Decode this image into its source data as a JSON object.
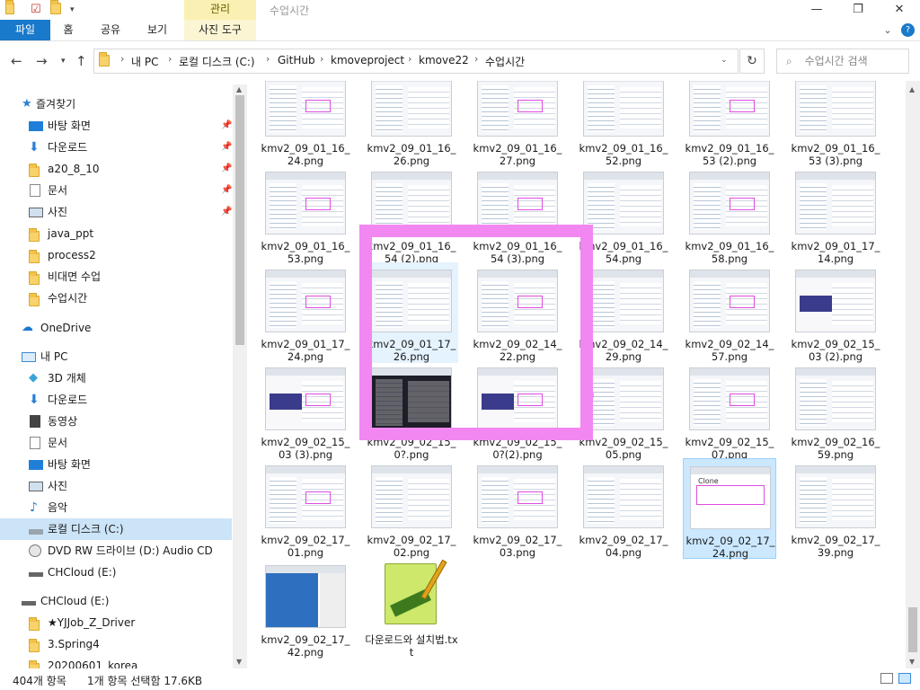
{
  "window": {
    "title": "수업시간",
    "context_tab": "관리",
    "minimize": "—",
    "maximize": "❐",
    "close": "✕"
  },
  "ribbon": {
    "tabs": [
      "파일",
      "홈",
      "공유",
      "보기",
      "사진 도구"
    ],
    "help": "?",
    "expand": "⌄"
  },
  "address": {
    "segments": [
      "내 PC",
      "로컬 디스크 (C:)",
      "GitHub",
      "kmoveproject",
      "kmove22",
      "수업시간"
    ],
    "search_placeholder": "수업시간 검색"
  },
  "sidebar": {
    "items": [
      {
        "label": "즐겨찾기",
        "icon": "star-icon",
        "pinned": false
      },
      {
        "label": "바탕 화면",
        "icon": "desktop-icon",
        "pinned": true
      },
      {
        "label": "다운로드",
        "icon": "download-icon",
        "pinned": true
      },
      {
        "label": "a20_8_10",
        "icon": "folder-icon",
        "pinned": true
      },
      {
        "label": "문서",
        "icon": "document-icon",
        "pinned": true
      },
      {
        "label": "사진",
        "icon": "pictures-icon",
        "pinned": true
      },
      {
        "label": "java_ppt",
        "icon": "folder-icon",
        "pinned": false
      },
      {
        "label": "process2",
        "icon": "folder-icon",
        "pinned": false
      },
      {
        "label": "비대면 수업",
        "icon": "folder-icon",
        "pinned": false
      },
      {
        "label": "수업시간",
        "icon": "folder-icon",
        "pinned": false
      },
      {
        "label": "OneDrive",
        "icon": "cloud-icon",
        "pinned": false
      },
      {
        "label": "내 PC",
        "icon": "pc-icon",
        "pinned": false
      },
      {
        "label": "3D 개체",
        "icon": "cube-icon",
        "pinned": false
      },
      {
        "label": "다운로드",
        "icon": "download-icon",
        "pinned": false
      },
      {
        "label": "동영상",
        "icon": "video-icon",
        "pinned": false
      },
      {
        "label": "문서",
        "icon": "document-icon",
        "pinned": false
      },
      {
        "label": "바탕 화면",
        "icon": "desktop-icon",
        "pinned": false
      },
      {
        "label": "사진",
        "icon": "pictures-icon",
        "pinned": false
      },
      {
        "label": "음악",
        "icon": "music-icon",
        "pinned": false
      },
      {
        "label": "로컬 디스크 (C:)",
        "icon": "drive-icon",
        "pinned": false
      },
      {
        "label": "DVD RW 드라이브 (D:) Audio CD",
        "icon": "dvd-icon",
        "pinned": false
      },
      {
        "label": "CHCloud (E:)",
        "icon": "drive-icon",
        "pinned": false
      },
      {
        "label": "CHCloud (E:)",
        "icon": "drive-icon",
        "pinned": false
      },
      {
        "label": "★YJJob_Z_Driver",
        "icon": "folder-icon",
        "pinned": false
      },
      {
        "label": "3.Spring4",
        "icon": "folder-icon",
        "pinned": false
      },
      {
        "label": "20200601_korea",
        "icon": "folder-icon",
        "pinned": false
      }
    ]
  },
  "files": [
    "kmv2_09_01_16_24.png",
    "kmv2_09_01_16_26.png",
    "kmv2_09_01_16_27.png",
    "kmv2_09_01_16_52.png",
    "kmv2_09_01_16_53 (2).png",
    "kmv2_09_01_16_53 (3).png",
    "kmv2_09_01_16_53.png",
    "kmv2_09_01_16_54 (2).png",
    "kmv2_09_01_16_54 (3).png",
    "kmv2_09_01_16_54.png",
    "kmv2_09_01_16_58.png",
    "kmv2_09_01_17_14.png",
    "kmv2_09_01_17_24.png",
    "kmv2_09_01_17_26.png",
    "kmv2_09_02_14_22.png",
    "kmv2_09_02_14_29.png",
    "kmv2_09_02_14_57.png",
    "kmv2_09_02_15_03 (2).png",
    "kmv2_09_02_15_03 (3).png",
    "kmv2_09_02_15_0?.png",
    "kmv2_09_02_15_0?(2).png",
    "kmv2_09_02_15_05.png",
    "kmv2_09_02_15_07.png",
    "kmv2_09_02_16_59.png",
    "kmv2_09_02_17_01.png",
    "kmv2_09_02_17_02.png",
    "kmv2_09_02_17_03.png",
    "kmv2_09_02_17_04.png",
    "kmv2_09_02_17_24.png",
    "kmv2_09_02_17_39.png",
    "kmv2_09_02_17_42.png",
    "다운로드와 설치법.txt"
  ],
  "thumb_text": {
    "clone": "Clone",
    "notepad": "Notepad++"
  },
  "status": {
    "count": "404개 항목",
    "selected": "1개 항목 선택함 17.6KB"
  },
  "colors": {
    "file_tab": "#1979ca",
    "manage_tab": "#fbf0b3",
    "selection": "#cce8ff",
    "overlay": "#f287f2"
  }
}
